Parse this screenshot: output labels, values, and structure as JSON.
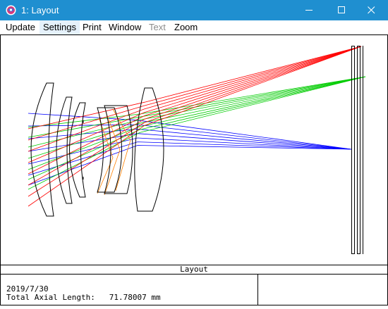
{
  "window": {
    "title": "1: Layout",
    "title_icon": "zemax-app-icon",
    "controls": [
      "minimize-icon",
      "maximize-icon",
      "close-icon"
    ]
  },
  "menu": {
    "items": [
      {
        "label": "Update",
        "state": "normal"
      },
      {
        "label": "Settings",
        "state": "hover"
      },
      {
        "label": "Print",
        "state": "normal"
      },
      {
        "label": "Window",
        "state": "normal"
      },
      {
        "label": "Text",
        "state": "disabled"
      },
      {
        "label": "Zoom",
        "state": "normal"
      }
    ]
  },
  "layout": {
    "caption": "Layout",
    "date": "2019/7/30",
    "axial_length_label": "Total Axial Length:",
    "axial_length_value": "71.78007 mm",
    "ray_colors": {
      "field_1": "#0000ff",
      "field_2": "#00cc00",
      "field_3": "#ff0000",
      "marginal": "#ff8000"
    }
  }
}
